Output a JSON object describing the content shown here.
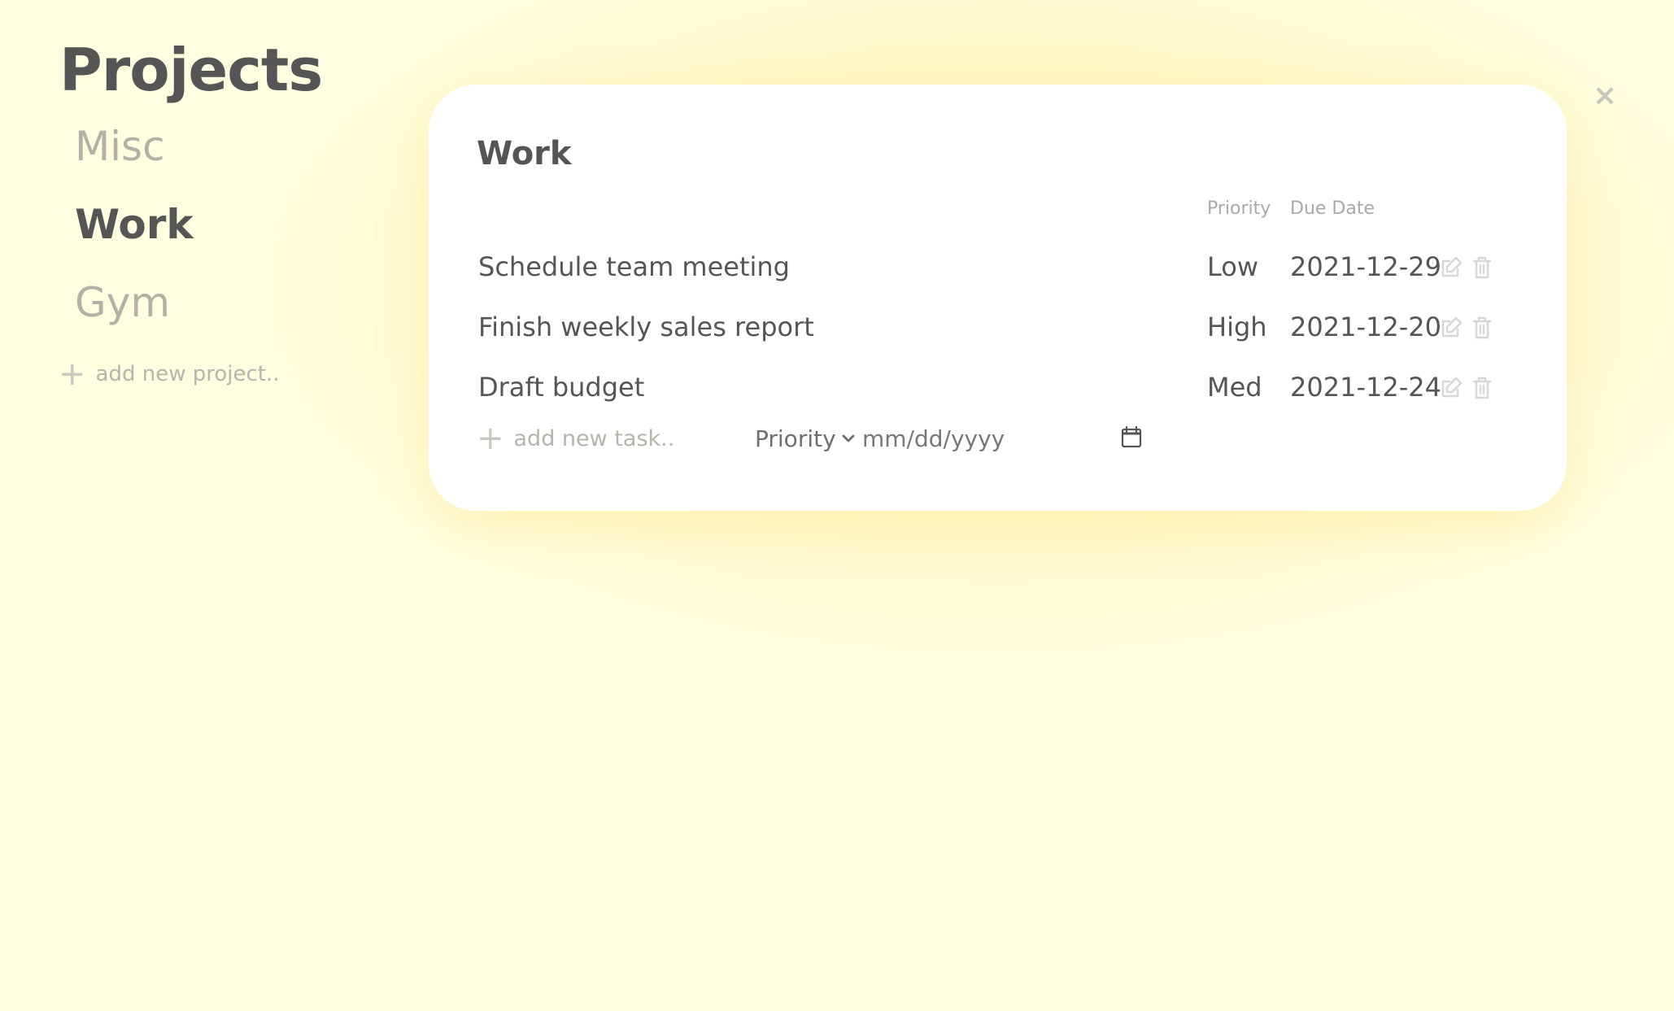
{
  "sidebar": {
    "title": "Projects",
    "projects": [
      {
        "name": "Misc",
        "active": false
      },
      {
        "name": "Work",
        "active": true
      },
      {
        "name": "Gym",
        "active": false
      }
    ],
    "add_project_label": "add new project.."
  },
  "modal": {
    "title": "Work",
    "columns": {
      "priority": "Priority",
      "due_date": "Due Date"
    },
    "tasks": [
      {
        "title": "Schedule team meeting",
        "priority": "Low",
        "due": "2021-12-29"
      },
      {
        "title": "Finish weekly sales report",
        "priority": "High",
        "due": "2021-12-20"
      },
      {
        "title": "Draft budget",
        "priority": "Med",
        "due": "2021-12-24"
      }
    ],
    "new_task": {
      "placeholder": "add new task..",
      "priority_label": "Priority",
      "date_placeholder": "mm/dd/yyyy"
    },
    "close_symbol": "×"
  },
  "colors": {
    "background": "#fffee0",
    "text": "#555555",
    "muted": "#b1b1a6",
    "card": "#ffffff"
  },
  "icons": {
    "edit": "edit-icon",
    "delete": "trash-icon",
    "close": "close-icon",
    "calendar": "calendar-icon",
    "dropdown": "chevron-down-icon",
    "add": "plus-icon"
  }
}
